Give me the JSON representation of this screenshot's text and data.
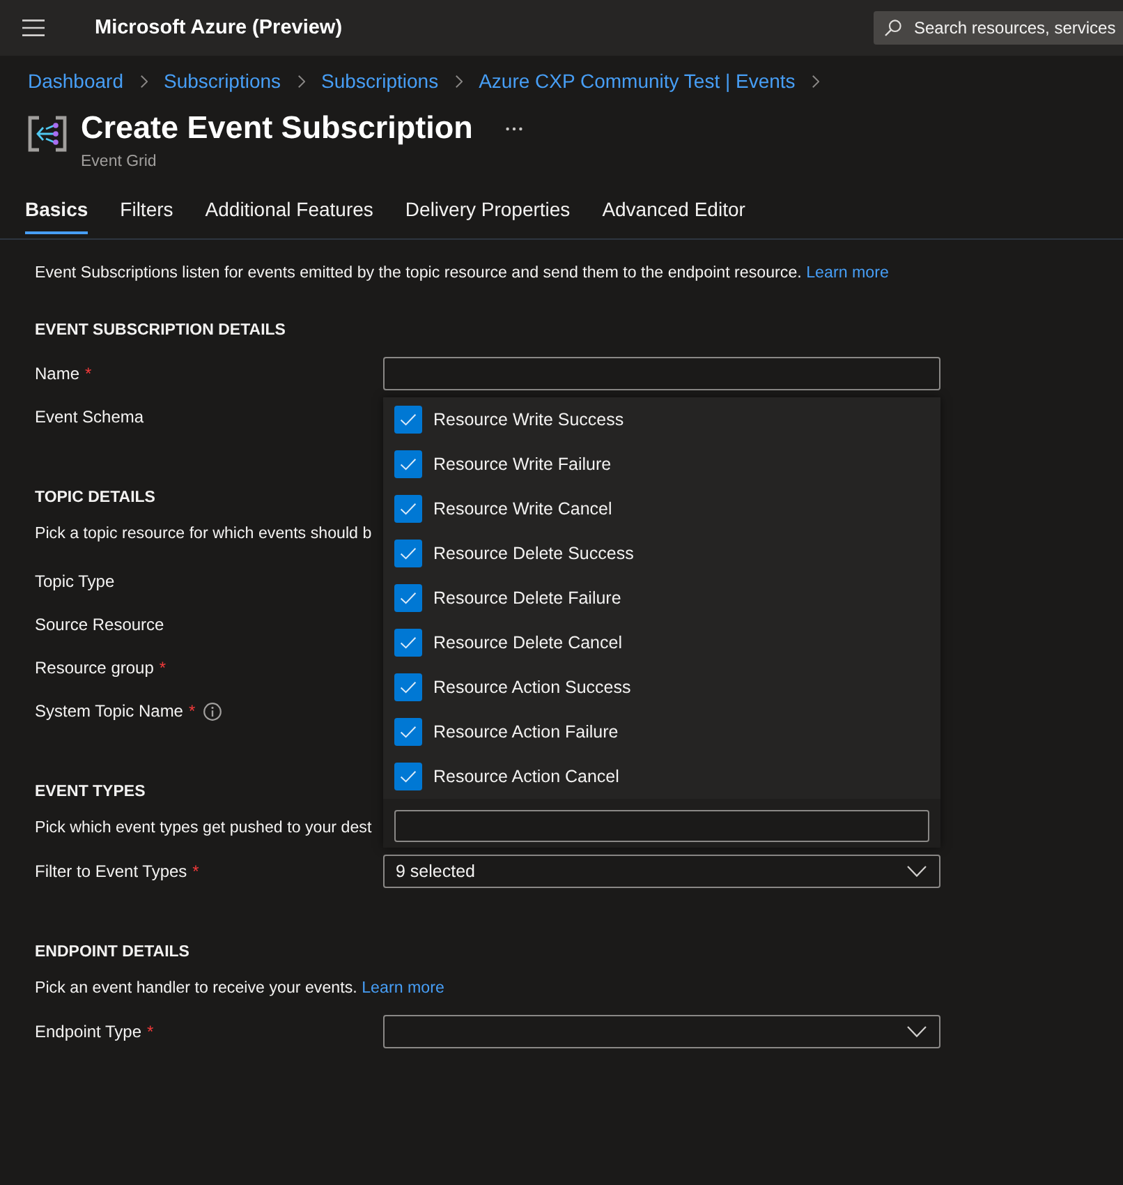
{
  "header": {
    "app_title": "Microsoft Azure (Preview)",
    "search": {
      "placeholder": "Search resources, services"
    }
  },
  "breadcrumb": [
    "Dashboard",
    "Subscriptions",
    "Subscriptions",
    "Azure CXP Community Test | Events"
  ],
  "page": {
    "title": "Create Event Subscription",
    "subtitle": "Event Grid"
  },
  "tabs": [
    {
      "label": "Basics",
      "selected": true
    },
    {
      "label": "Filters",
      "selected": false
    },
    {
      "label": "Additional Features",
      "selected": false
    },
    {
      "label": "Delivery Properties",
      "selected": false
    },
    {
      "label": "Advanced Editor",
      "selected": false
    }
  ],
  "form": {
    "intro": {
      "text": "Event Subscriptions listen for events emitted by the topic resource and send them to the endpoint resource.",
      "link": "Learn more"
    },
    "sections": [
      {
        "heading": "EVENT SUBSCRIPTION DETAILS",
        "rows": [
          {
            "kind": "text_input",
            "label": "Name",
            "marker": "*"
          },
          {
            "kind": "label",
            "label": "Event Schema"
          }
        ]
      },
      {
        "heading": "TOPIC DETAILS",
        "rows": [
          {
            "kind": "note",
            "text": "Pick a topic resource for which events should b"
          },
          {
            "kind": "label",
            "label": "Topic Type"
          },
          {
            "kind": "label",
            "label": "Source Resource"
          },
          {
            "kind": "label",
            "label": "Resource group",
            "marker": "*"
          },
          {
            "kind": "label",
            "label": "System Topic Name",
            "marker": "*",
            "info": true
          }
        ]
      },
      {
        "heading": "EVENT TYPES",
        "rows": [
          {
            "kind": "note",
            "text": "Pick which event types get pushed to your dest"
          },
          {
            "kind": "dropdown",
            "label": "Filter to Event Types",
            "marker": "*",
            "value": "9 selected",
            "expanded": true,
            "options": [
              {
                "label": "Resource Write Success",
                "checked": true
              },
              {
                "label": "Resource Write Failure",
                "checked": true
              },
              {
                "label": "Resource Write Cancel",
                "checked": true
              },
              {
                "label": "Resource Delete Success",
                "checked": true
              },
              {
                "label": "Resource Delete Failure",
                "checked": true
              },
              {
                "label": "Resource Delete Cancel",
                "checked": true
              },
              {
                "label": "Resource Action Success",
                "checked": true
              },
              {
                "label": "Resource Action Failure",
                "checked": true
              },
              {
                "label": "Resource Action Cancel",
                "checked": true
              }
            ]
          }
        ]
      },
      {
        "heading": "ENDPOINT DETAILS",
        "rows": [
          {
            "kind": "note",
            "text": "Pick an event handler to receive your events.",
            "link": "Learn more"
          },
          {
            "kind": "dropdown",
            "label": "Endpoint Type",
            "marker": "*"
          }
        ]
      }
    ]
  }
}
